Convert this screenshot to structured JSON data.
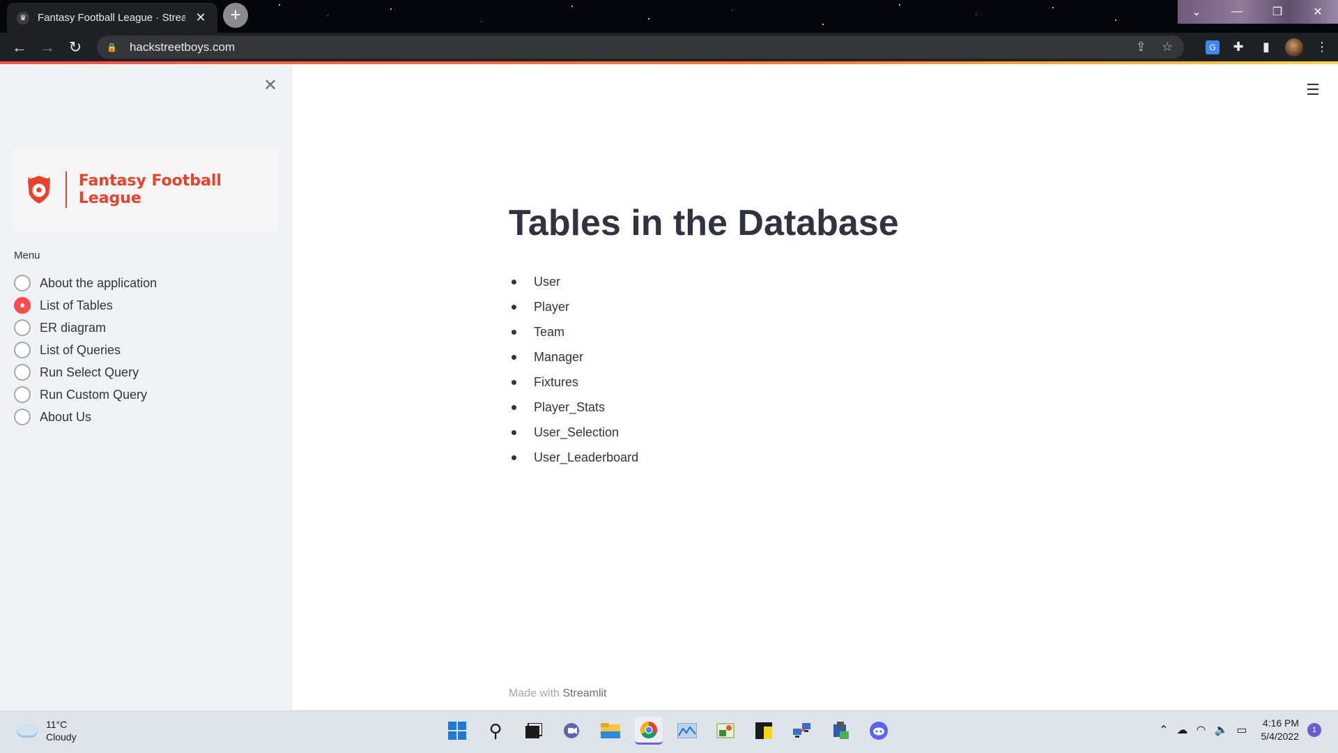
{
  "browser": {
    "tab_title": "Fantasy Football League · Streamlit",
    "url": "hackstreetboys.com"
  },
  "sidebar": {
    "logo_text": "Fantasy Football League",
    "menu_label": "Menu",
    "options": [
      {
        "label": "About the application",
        "selected": false
      },
      {
        "label": "List of Tables",
        "selected": true
      },
      {
        "label": "ER diagram",
        "selected": false
      },
      {
        "label": "List of Queries",
        "selected": false
      },
      {
        "label": "Run Select Query",
        "selected": false
      },
      {
        "label": "Run Custom Query",
        "selected": false
      },
      {
        "label": "About Us",
        "selected": false
      }
    ]
  },
  "main": {
    "heading": "Tables in the Database",
    "tables": [
      "User",
      "Player",
      "Team",
      "Manager",
      "Fixtures",
      "Player_Stats",
      "User_Selection",
      "User_Leaderboard"
    ],
    "footer_prefix": "Made with",
    "footer_link": "Streamlit"
  },
  "taskbar": {
    "temperature": "11°C",
    "condition": "Cloudy",
    "time": "4:16 PM",
    "date": "5/4/2022",
    "notification_count": "1"
  },
  "colors": {
    "accent": "#ff4b4b",
    "logo": "#e8412c",
    "sidebar_bg": "#f0f2f6"
  }
}
